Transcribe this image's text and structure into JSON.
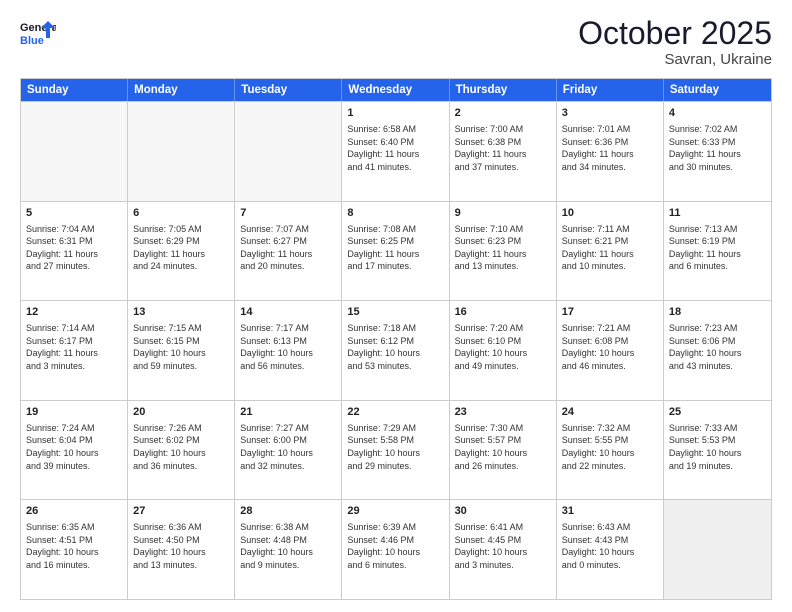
{
  "header": {
    "logo_general": "General",
    "logo_blue": "Blue",
    "month": "October 2025",
    "location": "Savran, Ukraine"
  },
  "days_of_week": [
    "Sunday",
    "Monday",
    "Tuesday",
    "Wednesday",
    "Thursday",
    "Friday",
    "Saturday"
  ],
  "rows": [
    [
      {
        "day": "",
        "empty": true
      },
      {
        "day": "",
        "empty": true
      },
      {
        "day": "",
        "empty": true
      },
      {
        "day": "1",
        "lines": [
          "Sunrise: 6:58 AM",
          "Sunset: 6:40 PM",
          "Daylight: 11 hours",
          "and 41 minutes."
        ]
      },
      {
        "day": "2",
        "lines": [
          "Sunrise: 7:00 AM",
          "Sunset: 6:38 PM",
          "Daylight: 11 hours",
          "and 37 minutes."
        ]
      },
      {
        "day": "3",
        "lines": [
          "Sunrise: 7:01 AM",
          "Sunset: 6:36 PM",
          "Daylight: 11 hours",
          "and 34 minutes."
        ]
      },
      {
        "day": "4",
        "lines": [
          "Sunrise: 7:02 AM",
          "Sunset: 6:33 PM",
          "Daylight: 11 hours",
          "and 30 minutes."
        ]
      }
    ],
    [
      {
        "day": "5",
        "lines": [
          "Sunrise: 7:04 AM",
          "Sunset: 6:31 PM",
          "Daylight: 11 hours",
          "and 27 minutes."
        ]
      },
      {
        "day": "6",
        "lines": [
          "Sunrise: 7:05 AM",
          "Sunset: 6:29 PM",
          "Daylight: 11 hours",
          "and 24 minutes."
        ]
      },
      {
        "day": "7",
        "lines": [
          "Sunrise: 7:07 AM",
          "Sunset: 6:27 PM",
          "Daylight: 11 hours",
          "and 20 minutes."
        ]
      },
      {
        "day": "8",
        "lines": [
          "Sunrise: 7:08 AM",
          "Sunset: 6:25 PM",
          "Daylight: 11 hours",
          "and 17 minutes."
        ]
      },
      {
        "day": "9",
        "lines": [
          "Sunrise: 7:10 AM",
          "Sunset: 6:23 PM",
          "Daylight: 11 hours",
          "and 13 minutes."
        ]
      },
      {
        "day": "10",
        "lines": [
          "Sunrise: 7:11 AM",
          "Sunset: 6:21 PM",
          "Daylight: 11 hours",
          "and 10 minutes."
        ]
      },
      {
        "day": "11",
        "lines": [
          "Sunrise: 7:13 AM",
          "Sunset: 6:19 PM",
          "Daylight: 11 hours",
          "and 6 minutes."
        ]
      }
    ],
    [
      {
        "day": "12",
        "lines": [
          "Sunrise: 7:14 AM",
          "Sunset: 6:17 PM",
          "Daylight: 11 hours",
          "and 3 minutes."
        ]
      },
      {
        "day": "13",
        "lines": [
          "Sunrise: 7:15 AM",
          "Sunset: 6:15 PM",
          "Daylight: 10 hours",
          "and 59 minutes."
        ]
      },
      {
        "day": "14",
        "lines": [
          "Sunrise: 7:17 AM",
          "Sunset: 6:13 PM",
          "Daylight: 10 hours",
          "and 56 minutes."
        ]
      },
      {
        "day": "15",
        "lines": [
          "Sunrise: 7:18 AM",
          "Sunset: 6:12 PM",
          "Daylight: 10 hours",
          "and 53 minutes."
        ]
      },
      {
        "day": "16",
        "lines": [
          "Sunrise: 7:20 AM",
          "Sunset: 6:10 PM",
          "Daylight: 10 hours",
          "and 49 minutes."
        ]
      },
      {
        "day": "17",
        "lines": [
          "Sunrise: 7:21 AM",
          "Sunset: 6:08 PM",
          "Daylight: 10 hours",
          "and 46 minutes."
        ]
      },
      {
        "day": "18",
        "lines": [
          "Sunrise: 7:23 AM",
          "Sunset: 6:06 PM",
          "Daylight: 10 hours",
          "and 43 minutes."
        ]
      }
    ],
    [
      {
        "day": "19",
        "lines": [
          "Sunrise: 7:24 AM",
          "Sunset: 6:04 PM",
          "Daylight: 10 hours",
          "and 39 minutes."
        ]
      },
      {
        "day": "20",
        "lines": [
          "Sunrise: 7:26 AM",
          "Sunset: 6:02 PM",
          "Daylight: 10 hours",
          "and 36 minutes."
        ]
      },
      {
        "day": "21",
        "lines": [
          "Sunrise: 7:27 AM",
          "Sunset: 6:00 PM",
          "Daylight: 10 hours",
          "and 32 minutes."
        ]
      },
      {
        "day": "22",
        "lines": [
          "Sunrise: 7:29 AM",
          "Sunset: 5:58 PM",
          "Daylight: 10 hours",
          "and 29 minutes."
        ]
      },
      {
        "day": "23",
        "lines": [
          "Sunrise: 7:30 AM",
          "Sunset: 5:57 PM",
          "Daylight: 10 hours",
          "and 26 minutes."
        ]
      },
      {
        "day": "24",
        "lines": [
          "Sunrise: 7:32 AM",
          "Sunset: 5:55 PM",
          "Daylight: 10 hours",
          "and 22 minutes."
        ]
      },
      {
        "day": "25",
        "lines": [
          "Sunrise: 7:33 AM",
          "Sunset: 5:53 PM",
          "Daylight: 10 hours",
          "and 19 minutes."
        ]
      }
    ],
    [
      {
        "day": "26",
        "lines": [
          "Sunrise: 6:35 AM",
          "Sunset: 4:51 PM",
          "Daylight: 10 hours",
          "and 16 minutes."
        ]
      },
      {
        "day": "27",
        "lines": [
          "Sunrise: 6:36 AM",
          "Sunset: 4:50 PM",
          "Daylight: 10 hours",
          "and 13 minutes."
        ]
      },
      {
        "day": "28",
        "lines": [
          "Sunrise: 6:38 AM",
          "Sunset: 4:48 PM",
          "Daylight: 10 hours",
          "and 9 minutes."
        ]
      },
      {
        "day": "29",
        "lines": [
          "Sunrise: 6:39 AM",
          "Sunset: 4:46 PM",
          "Daylight: 10 hours",
          "and 6 minutes."
        ]
      },
      {
        "day": "30",
        "lines": [
          "Sunrise: 6:41 AM",
          "Sunset: 4:45 PM",
          "Daylight: 10 hours",
          "and 3 minutes."
        ]
      },
      {
        "day": "31",
        "lines": [
          "Sunrise: 6:43 AM",
          "Sunset: 4:43 PM",
          "Daylight: 10 hours",
          "and 0 minutes."
        ]
      },
      {
        "day": "",
        "empty": true,
        "shaded": true
      }
    ]
  ]
}
